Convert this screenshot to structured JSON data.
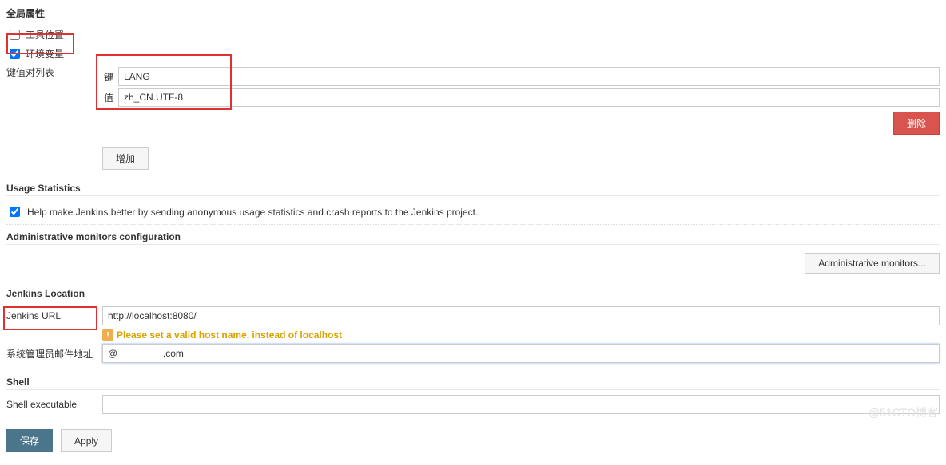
{
  "global": {
    "heading": "全局属性",
    "tools_loc_label": "工具位置",
    "env_vars_label": "环境变量",
    "env_vars_checked": true,
    "kv_list_label": "键值对列表",
    "key_label": "键",
    "key_value": "LANG",
    "val_label": "值",
    "val_value": "zh_CN.UTF-8",
    "delete_btn": "删除",
    "add_btn": "增加"
  },
  "usage": {
    "heading": "Usage Statistics",
    "help_label": "Help make Jenkins better by sending anonymous usage statistics and crash reports to the Jenkins project.",
    "checked": true
  },
  "admin_monitors": {
    "heading": "Administrative monitors configuration",
    "button": "Administrative monitors..."
  },
  "location": {
    "heading": "Jenkins Location",
    "url_label": "Jenkins URL",
    "url_value": "http://localhost:8080/",
    "warning_text": "Please set a valid host name, instead of localhost",
    "admin_email_label": "系统管理员邮件地址",
    "admin_email_value": "@                 .com"
  },
  "shell": {
    "heading": "Shell",
    "exec_label": "Shell executable",
    "exec_value": ""
  },
  "buttons": {
    "save": "保存",
    "apply": "Apply"
  },
  "watermark": "@51CTO博客"
}
